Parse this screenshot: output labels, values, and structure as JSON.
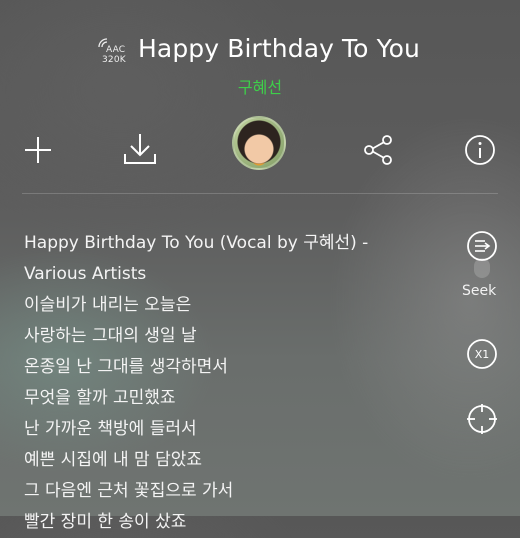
{
  "header": {
    "quality_codec": "AAC",
    "quality_bitrate": "320K",
    "title": "Happy Birthday To You",
    "artist": "구혜선"
  },
  "toolbar": {
    "icons": [
      "plus-icon",
      "download-icon",
      "album-avatar",
      "share-icon",
      "info-icon"
    ]
  },
  "lyrics": {
    "lines": [
      "Happy Birthday To You (Vocal by 구혜선) -",
      "Various Artists",
      "이슬비가 내리는 오늘은",
      "사랑하는 그대의 생일 날",
      "온종일 난 그대를 생각하면서",
      "무엇을 할까 고민했죠",
      "난 가까운 책방에 들러서",
      "예쁜 시집에 내 맘 담았죠",
      "그 다음엔 근처 꽃집으로 가서",
      "빨간 장미 한 송이 샀죠"
    ]
  },
  "side": {
    "seek_label": "Seek",
    "speed_label": "X1"
  },
  "colors": {
    "accent_green": "#3ecf4a"
  }
}
